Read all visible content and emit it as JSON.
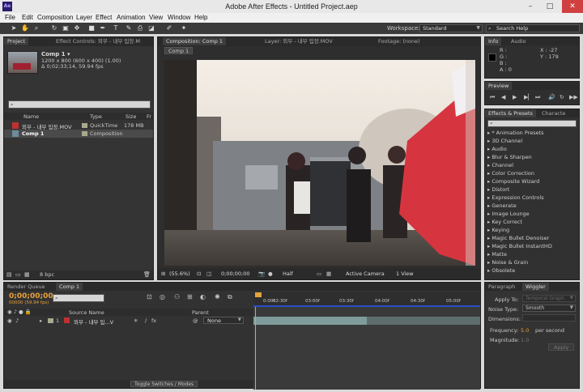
{
  "window": {
    "title": "Adobe After Effects - Untitled Project.aep",
    "app_icon": "Ae",
    "minimize": "–",
    "maximize": "□",
    "close": "✕"
  },
  "menu": [
    "File",
    "Edit",
    "Composition",
    "Layer",
    "Effect",
    "Animation",
    "View",
    "Window",
    "Help"
  ],
  "toolbar": {
    "workspace_label": "Workspace:",
    "workspace_value": "Standard",
    "search_help": "Search Help"
  },
  "project_panel": {
    "tab_project": "Project",
    "tab_effect_controls": "Effect Controls: 외부 - 내부 입장.M",
    "comp_name": "Comp 1 ▾",
    "comp_info_1": "1200 x 800  (600 x 400) (1.00)",
    "comp_info_2": "Δ 0;02;33;14, 59.94 fps",
    "search_placeholder": "",
    "columns": {
      "name": "Name",
      "type": "Type",
      "size": "Size",
      "fr": "Fr"
    },
    "items": [
      {
        "name": "외부 - 내부 입장.MOV",
        "type": "QuickTime",
        "size": "178 MB"
      },
      {
        "name": "Comp 1",
        "type": "Composition",
        "size": ""
      }
    ],
    "bpc": "8 bpc"
  },
  "composition_panel": {
    "tab_comp": "Composition: Comp 1",
    "tab_layer": "Layer: 외부 - 내부 입장.MOV",
    "tab_footage": "Footage: (none)",
    "breadcrumb": "Comp 1",
    "zoom": "(55.6%)",
    "timecode": "0;00;00;00",
    "resolution": "Half",
    "camera": "Active Camera",
    "views": "1 View"
  },
  "info_panel": {
    "tab_info": "Info",
    "tab_audio": "Audio",
    "r_label": "R :",
    "g_label": "G :",
    "b_label": "B :",
    "a_label": "A : 0",
    "x_value": "X : -27",
    "y_value": "Y : 179"
  },
  "preview_panel": {
    "tab": "Preview"
  },
  "effects_panel": {
    "tab_effects": "Effects & Presets",
    "tab_character": "Characte",
    "search_placeholder": "",
    "items": [
      "* Animation Presets",
      "3D Channel",
      "Audio",
      "Blur & Sharpen",
      "Channel",
      "Color Correction",
      "Composite Wizard",
      "Distort",
      "Expression Controls",
      "Generate",
      "Image Lounge",
      "Key Correct",
      "Keying",
      "Magic Bullet Denoiser",
      "Magic Bullet InstantHD",
      "Matte",
      "Noise & Grain",
      "Obsolete"
    ]
  },
  "timeline_panel": {
    "tab_render": "Render Queue",
    "tab_comp": "Comp 1",
    "timecode": "0;00;00;00",
    "timecode_sub": "00000 (59.94 fps)",
    "search_placeholder": "",
    "ruler_labels": [
      "0:00f",
      "02:30f",
      "03:00f",
      "03:30f",
      "04:00f",
      "04:30f",
      "05:00f"
    ],
    "columns": {
      "source_name": "Source Name",
      "parent": "Parent"
    },
    "layers": [
      {
        "num": "1",
        "name": "외부 - 내부 입...V",
        "parent": "None"
      }
    ],
    "toggle_label": "Toggle Switches / Modes"
  },
  "wiggler_panel": {
    "tab_paragraph": "Paragraph",
    "tab_wiggler": "Wiggler",
    "apply_to_label": "Apply To:",
    "apply_to_value": "Temporal Graph",
    "noise_type_label": "Noise Type:",
    "noise_type_value": "Smooth",
    "dimensions_label": "Dimensions:",
    "frequency_label": "Frequency:",
    "frequency_value": "5.0",
    "per_second": "per second",
    "magnitude_label": "Magnitude:",
    "magnitude_value": "1.0",
    "apply_button": "Apply"
  }
}
